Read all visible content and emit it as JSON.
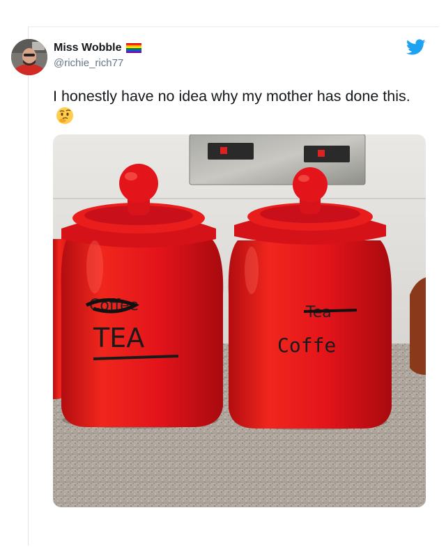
{
  "tweet": {
    "display_name": "Miss Wobble",
    "handle": "@richie_rich77",
    "text": "I honestly have no idea why my mother has done this.",
    "emoji": "thinking-face"
  },
  "photo": {
    "left_jar": {
      "crossed_label": "Coffee",
      "label": "TEA"
    },
    "right_jar": {
      "crossed_label": "Tea",
      "label": "Coffe"
    }
  },
  "colors": {
    "jar_red": "#e3141a",
    "twitter_blue": "#1da1f2",
    "handle_gray": "#657786"
  }
}
